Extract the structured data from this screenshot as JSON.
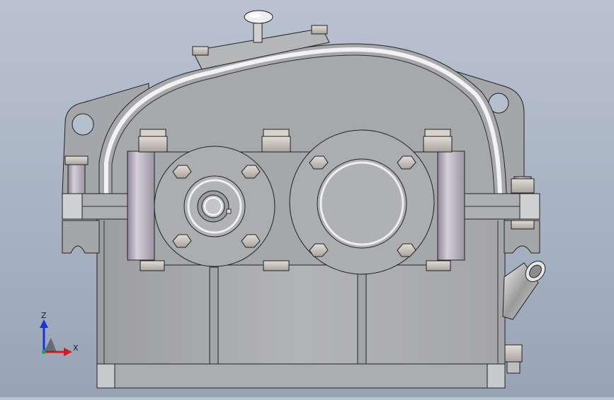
{
  "scene": {
    "model": "gear-reducer-housing",
    "view": "front",
    "colors": {
      "background_top": "#b9c2d0",
      "background_bottom": "#98a4b6",
      "housing": "#a9aaad",
      "housing_dark": "#8e9093",
      "housing_light": "#c8c9cb",
      "edge": "#222222",
      "bolt": "#c9c3bd",
      "accent_purple": "#8f8599"
    }
  },
  "triad": {
    "z_label": "Z",
    "x_label": "X",
    "z_color": "#1a33d8",
    "x_color": "#d81a1a",
    "origin_color": "#19a34a"
  }
}
